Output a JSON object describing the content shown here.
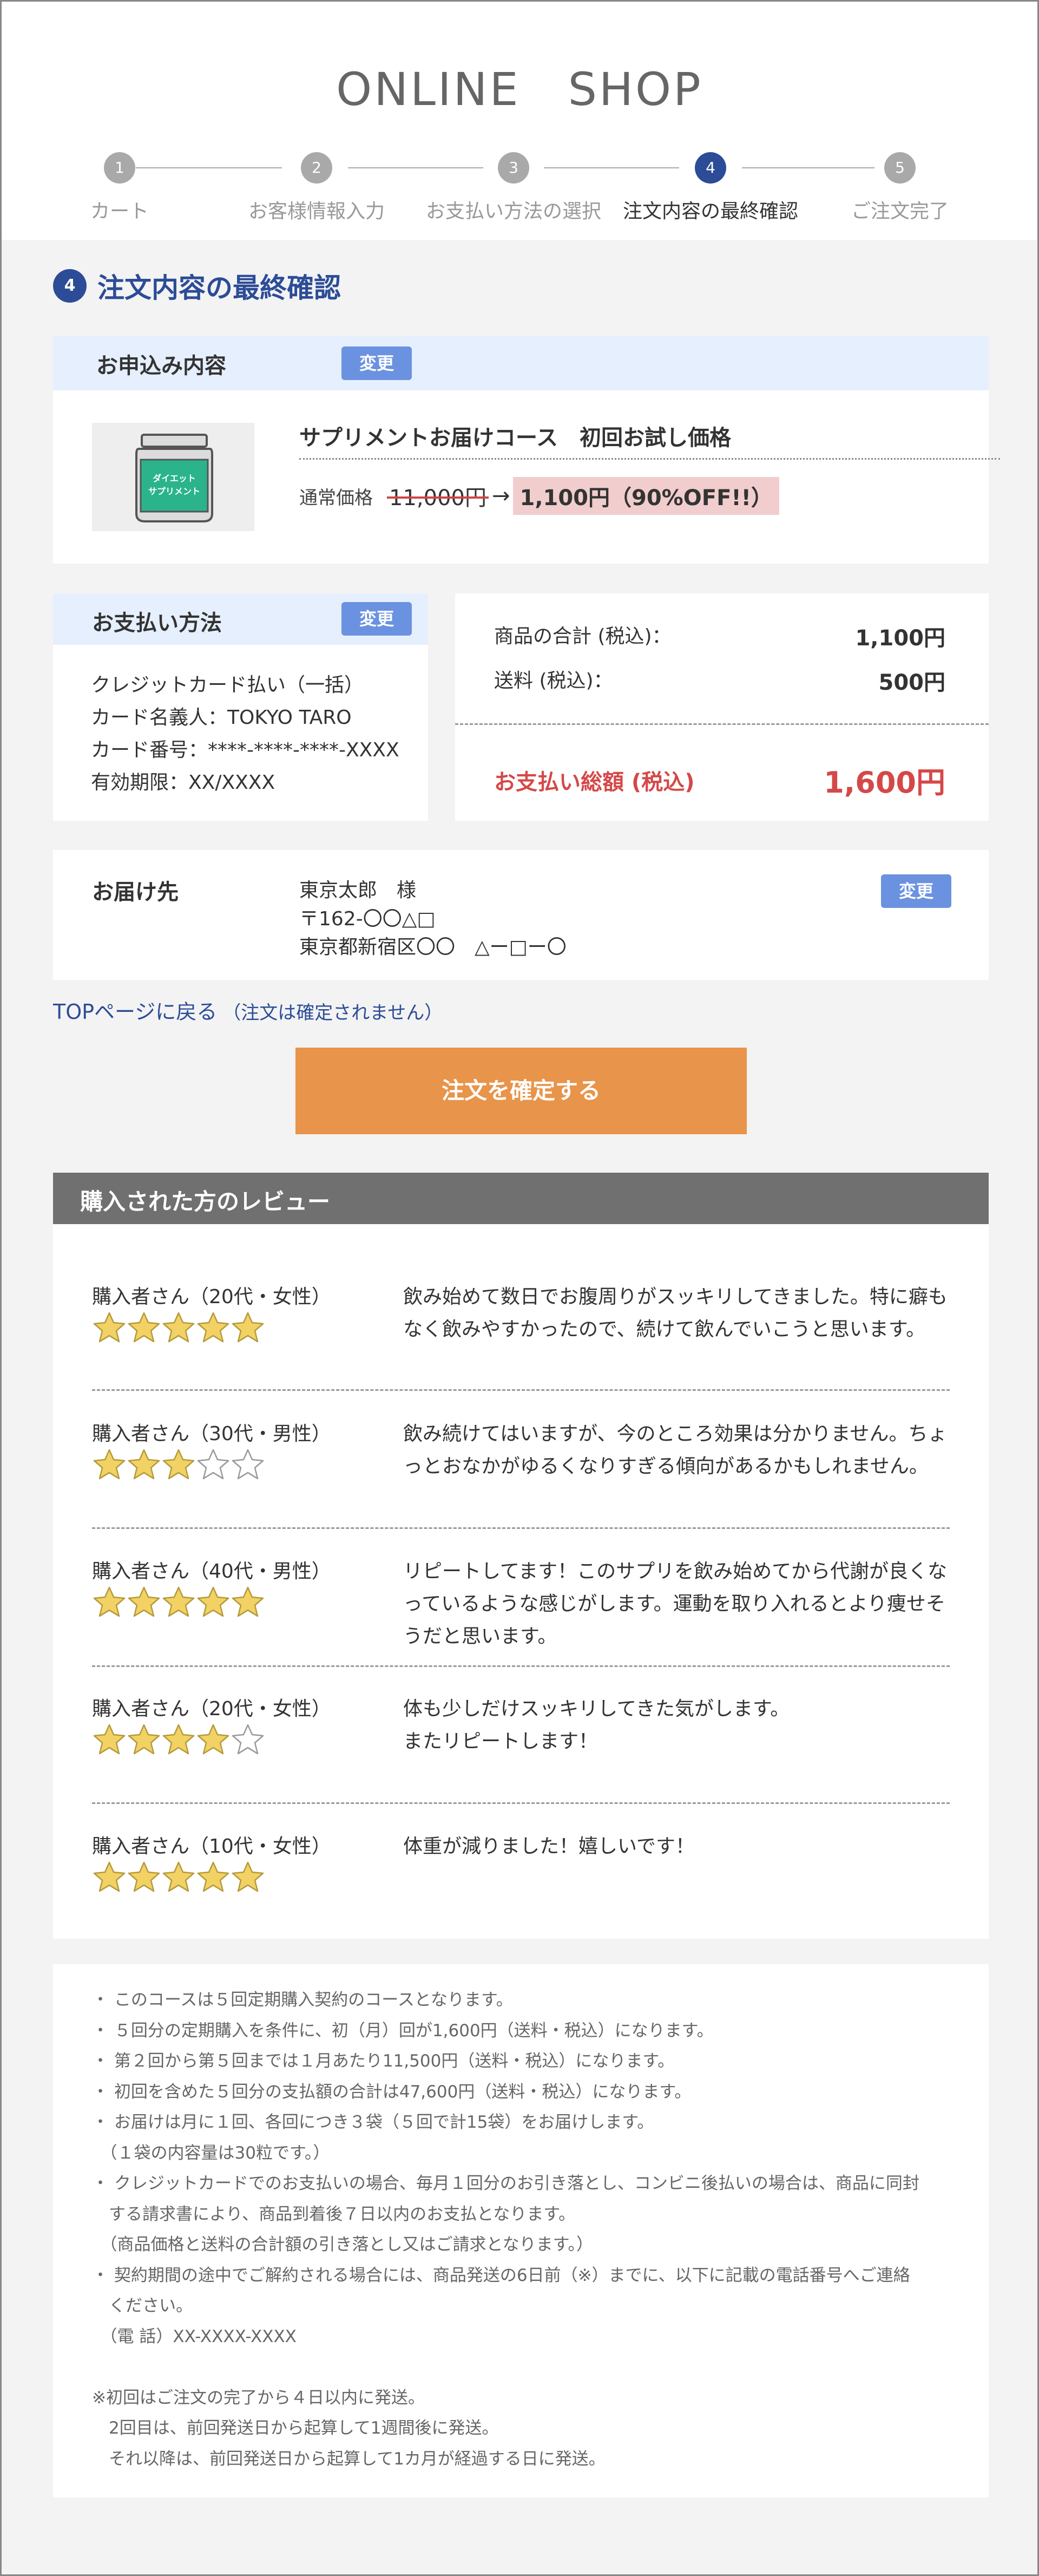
{
  "header": {
    "title": "ONLINE　SHOP"
  },
  "steps": [
    {
      "num": "1",
      "label": "カート",
      "active": false
    },
    {
      "num": "2",
      "label": "お客様情報入力",
      "active": false
    },
    {
      "num": "3",
      "label": "お支払い方法の選択",
      "active": false
    },
    {
      "num": "4",
      "label": "注文内容の最終確認",
      "active": true
    },
    {
      "num": "5",
      "label": "ご注文完了",
      "active": false
    }
  ],
  "section": {
    "badge": "4",
    "title": "注文内容の最終確認"
  },
  "order": {
    "label": "お申込み内容",
    "change": "変更",
    "product_image_text": [
      "ダイエット",
      "サプリメント"
    ],
    "product_name": "サプリメントお届けコース　初回お試し価格",
    "price_label": "通常価格",
    "price_old": "11,000円",
    "price_arrow": "→",
    "price_new": "1,100円（90%OFF!!）"
  },
  "payment": {
    "label": "お支払い方法",
    "change": "変更",
    "lines": [
      "クレジットカード払い（一括）",
      "カード名義人：TOKYO TARO",
      "カード番号：****-****-****-XXXX",
      "有効期限：XX/XXXX"
    ]
  },
  "summary": {
    "subtotal_label": "商品の合計 (税込)：",
    "subtotal_value": "1,100円",
    "shipping_label": "送料 (税込)：",
    "shipping_value": "500円",
    "total_label": "お支払い総額 (税込)",
    "total_value": "1,600円"
  },
  "delivery": {
    "label": "お届け先",
    "change": "変更",
    "name": "東京太郎　様",
    "zip": "〒162-〇〇△□",
    "address": "東京都新宿区〇〇　△ー□ー〇"
  },
  "top_link": {
    "text": "TOPページに戻る",
    "note": "（注文は確定されません）"
  },
  "confirm_button": "注文を確定する",
  "reviews": {
    "title": "購入された方のレビュー",
    "items": [
      {
        "user": "購入者さん（20代・女性）",
        "stars": 5,
        "text": "飲み始めて数日でお腹周りがスッキリしてきました。特に癖もなく飲みやすかったので、続けて飲んでいこうと思います。"
      },
      {
        "user": "購入者さん（30代・男性）",
        "stars": 3,
        "text": "飲み続けてはいますが、今のところ効果は分かりません。ちょっとおなかがゆるくなりすぎる傾向があるかもしれません。"
      },
      {
        "user": "購入者さん（40代・男性）",
        "stars": 5,
        "text": "リピートしてます！このサプリを飲み始めてから代謝が良くなっているような感じがします。運動を取り入れるとより痩せそうだと思います。"
      },
      {
        "user": "購入者さん（20代・女性）",
        "stars": 4,
        "text": "体も少しだけスッキリしてきた気がします。\nまたリピートします！"
      },
      {
        "user": "購入者さん（10代・女性）",
        "stars": 5,
        "text": "体重が減りました！嬉しいです！"
      }
    ]
  },
  "notes": [
    "・ このコースは５回定期購入契約のコースとなります。",
    "・ ５回分の定期購入を条件に、初（月）回が1,600円（送料・税込）になります。",
    "・ 第２回から第５回までは１月あたり11,500円（送料・税込）になります。",
    "・ 初回を含めた５回分の支払額の合計は47,600円（送料・税込）になります。",
    "・ お届けは月に１回、各回につき３袋（５回で計15袋）をお届けします。",
    "　（１袋の内容量は30粒です。）",
    "・ クレジットカードでのお支払いの場合、毎月１回分のお引き落とし、コンビニ後払いの場合は、商品に同封",
    "　する請求書により、商品到着後７日以内のお支払となります。",
    "　（商品価格と送料の合計額の引き落とし又はご請求となります。）",
    "・ 契約期間の途中でご解約される場合には、商品発送の6日前（※）までに、以下に記載の電話番号へご連絡",
    "　ください。",
    "　（電 話）XX-XXXX-XXXX",
    "",
    "※初回はご注文の完了から４日以内に発送。",
    "　2回目は、前回発送日から起算して1週間後に発送。",
    "　それ以降は、前回発送日から起算して1カ月が経過する日に発送。"
  ],
  "colors": {
    "accent": "#2c4c97",
    "change_button": "#6b92e0",
    "confirm_button": "#e8944a",
    "total": "#d54848",
    "star": "#f2d264"
  }
}
